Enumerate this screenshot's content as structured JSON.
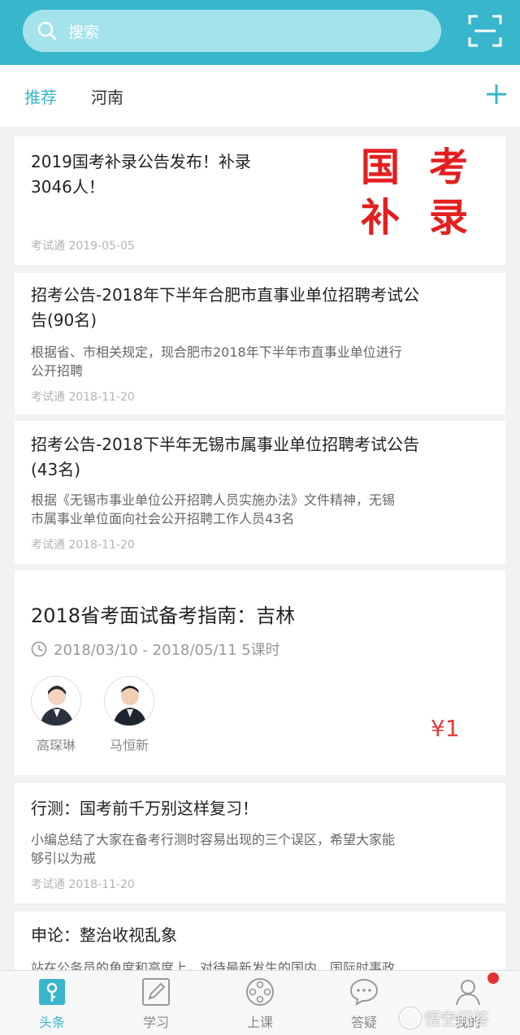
{
  "search": {
    "placeholder": "搜索"
  },
  "tabs": [
    {
      "label": "推荐",
      "active": true
    },
    {
      "label": "河南",
      "active": false
    }
  ],
  "colors": {
    "accent": "#38b6cc",
    "price": "#e23b3b",
    "stamp": "#e41f1f"
  },
  "articles": [
    {
      "title_lines": [
        "2019国考补录公告发布！补录",
        "3046人！"
      ],
      "source": "考试通 2019-05-05",
      "thumb_chars": [
        "国",
        "考",
        "补",
        "录"
      ]
    },
    {
      "title_lines": [
        "招考公告-2018年下半年合肥市直事业单位招聘考试公",
        "告(90名)"
      ],
      "summary_lines": [
        "根据省、市相关规定，现合肥市2018年下半年市直事业单位进行",
        "公开招聘"
      ],
      "source": "考试通 2018-11-20"
    },
    {
      "title_lines": [
        "招考公告-2018下半年无锡市属事业单位招聘考试公告",
        "(43名)"
      ],
      "summary_lines": [
        "根据《无锡市事业单位公开招聘人员实施办法》文件精神，无锡",
        "市属事业单位面向社会公开招聘工作人员43名"
      ],
      "source": "考试通 2018-11-20"
    }
  ],
  "course": {
    "title": "2018省考面试备考指南：吉林",
    "time": "2018/03/10 - 2018/05/11 5课时",
    "teachers": [
      {
        "name": "高琛琳"
      },
      {
        "name": "马恒新"
      }
    ],
    "price": "¥1"
  },
  "articles2": [
    {
      "title": "行测：国考前千万别这样复习！",
      "summary_lines": [
        "小编总结了大家在备考行测时容易出现的三个误区，希望大家能",
        "够引以为戒"
      ],
      "source": "考试通 2018-11-20"
    },
    {
      "title": "申论：整治收视乱象",
      "summary_lines": [
        "站在公务员的角度和高度上，对待最新发生的国内、国际时事政"
      ]
    }
  ],
  "bottom_nav": [
    {
      "label": "头条",
      "icon": "headline-icon",
      "active": true
    },
    {
      "label": "学习",
      "icon": "edit-icon",
      "active": false
    },
    {
      "label": "上课",
      "icon": "video-icon",
      "active": false
    },
    {
      "label": "答疑",
      "icon": "chat-icon",
      "active": false
    },
    {
      "label": "我的",
      "icon": "user-icon",
      "active": false,
      "badge": true
    }
  ],
  "watermark": "悟空问答"
}
